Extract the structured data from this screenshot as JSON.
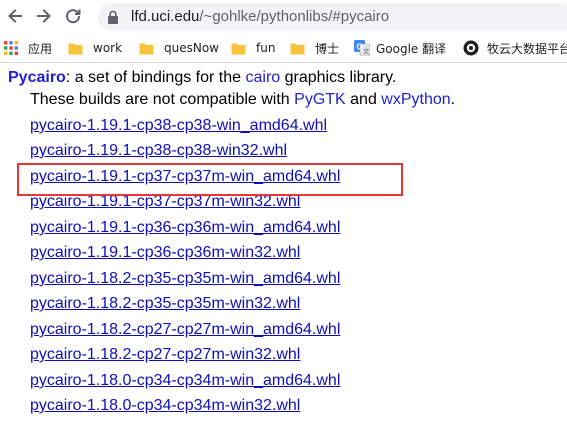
{
  "browser": {
    "url_host": "lfd.uci.edu",
    "url_path": "/~gohlke/pythonlibs/#pycairo"
  },
  "bookmarks": [
    {
      "label": "应用",
      "icon": "apps-grid-icon"
    },
    {
      "label": "work",
      "icon": "folder-icon"
    },
    {
      "label": "quesNow",
      "icon": "folder-icon"
    },
    {
      "label": "fun",
      "icon": "folder-icon"
    },
    {
      "label": "博士",
      "icon": "folder-icon"
    },
    {
      "label": "Google 翻译",
      "icon": "google-translate-icon"
    },
    {
      "label": "牧云大数据平台",
      "icon": "cloud-platform-icon"
    }
  ],
  "page": {
    "package_name": "Pycairo",
    "intro_part1": ": a set of bindings for the ",
    "intro_link": "cairo",
    "intro_part2": " graphics library.",
    "compat_part1": "These builds are not compatible with ",
    "compat_link1": "PyGTK",
    "compat_part2": " and ",
    "compat_link2": "wxPython",
    "compat_part3": ".",
    "downloads": [
      "pycairo-1.19.1-cp38-cp38-win_amd64.whl",
      "pycairo-1.19.1-cp38-cp38-win32.whl",
      "pycairo-1.19.1-cp37-cp37m-win_amd64.whl",
      "pycairo-1.19.1-cp37-cp37m-win32.whl",
      "pycairo-1.19.1-cp36-cp36m-win_amd64.whl",
      "pycairo-1.19.1-cp36-cp36m-win32.whl",
      "pycairo-1.18.2-cp35-cp35m-win_amd64.whl",
      "pycairo-1.18.2-cp35-cp35m-win32.whl",
      "pycairo-1.18.2-cp27-cp27m-win_amd64.whl",
      "pycairo-1.18.2-cp27-cp27m-win32.whl",
      "pycairo-1.18.0-cp34-cp34m-win_amd64.whl",
      "pycairo-1.18.0-cp34-cp34m-win32.whl"
    ],
    "highlighted_index": 2
  },
  "colors": {
    "link": "#0f0fb8",
    "highlight_border": "#e2383a",
    "folder": "#f8c23a"
  }
}
